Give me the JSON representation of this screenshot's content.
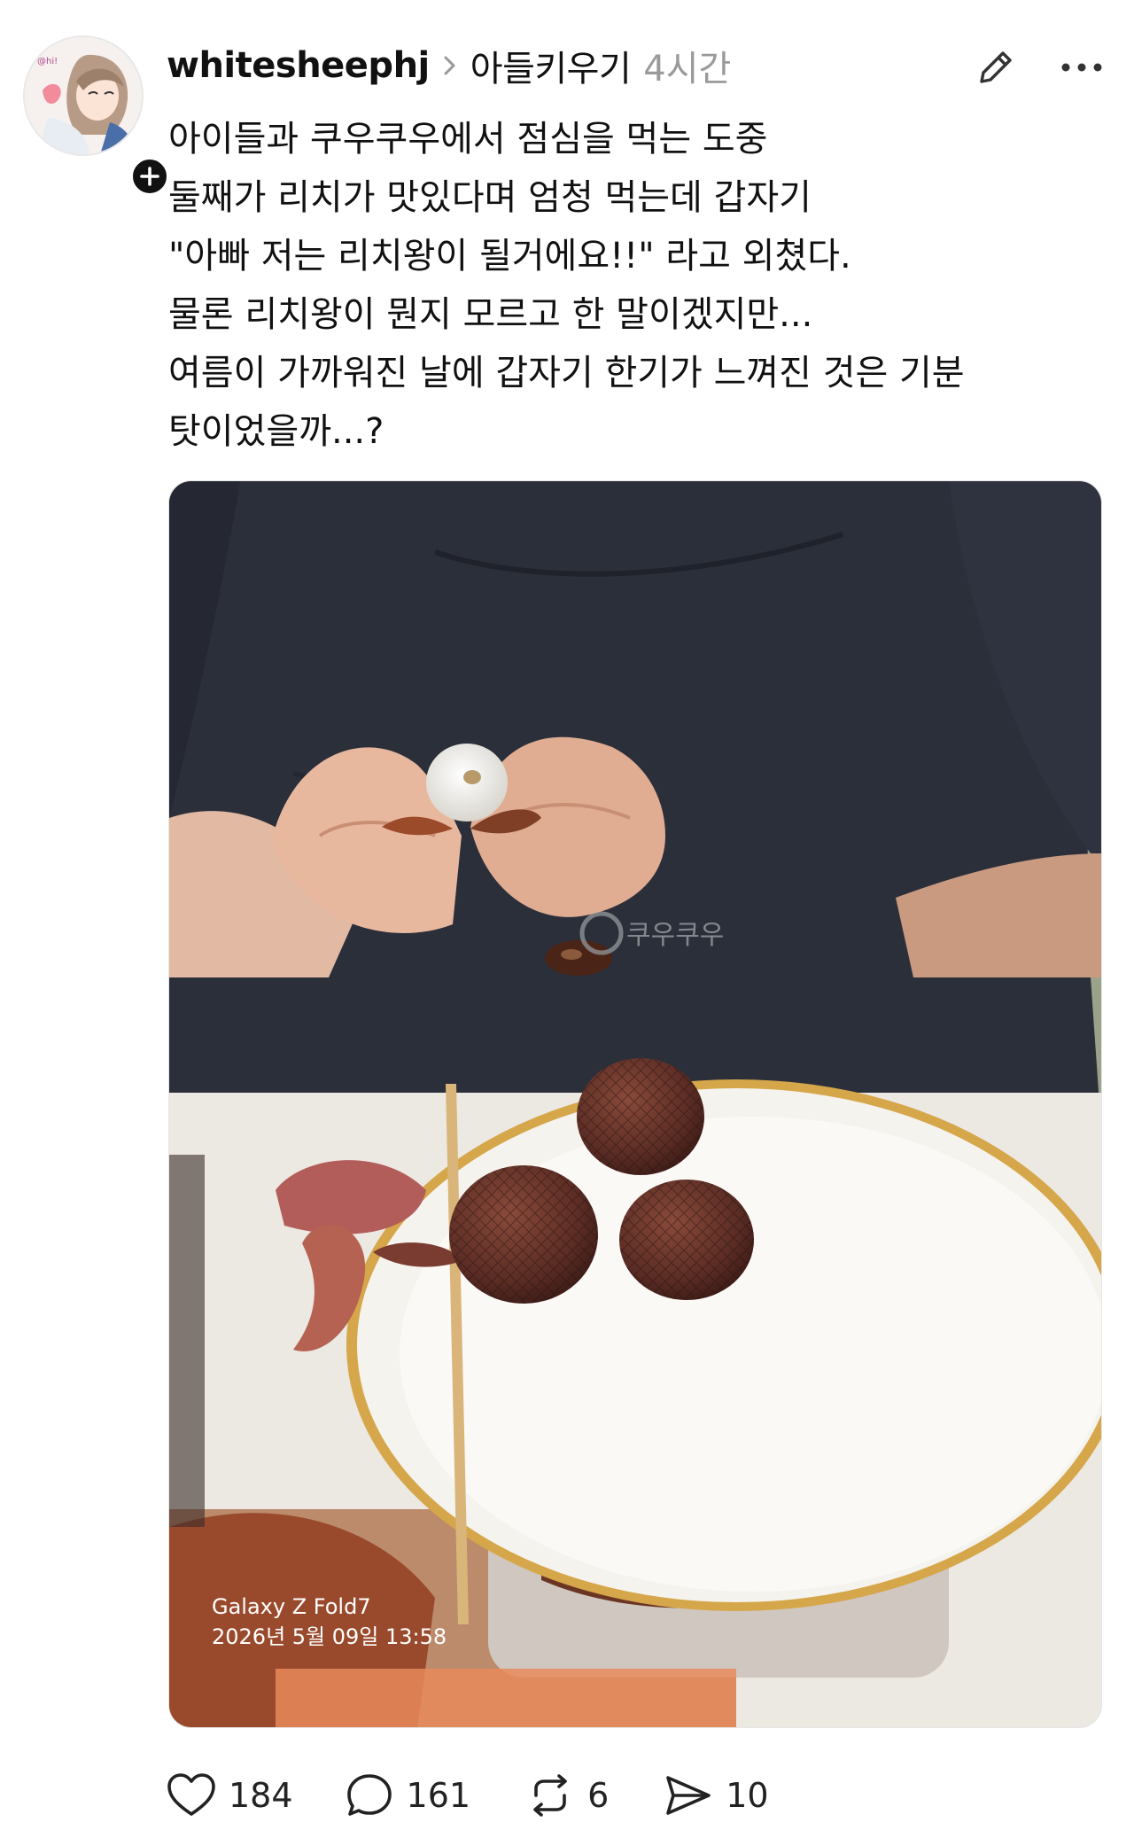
{
  "post": {
    "username": "whitesheephj",
    "community": "아들키우기",
    "time_ago": "4시간",
    "body_lines": [
      "아이들과 쿠우쿠우에서 점심을 먹는 도중",
      "둘째가 리치가 맛있다며 엄청 먹는데 갑자기",
      "\"아빠 저는 리치왕이 될거에요!!\" 라고 외쳤다.",
      "물론 리치왕이 뭔지 모르고 한 말이겠지만...",
      "여름이 가까워진 날에 갑자기 한기가 느껴진 것은 기분",
      "탓이었을까...?"
    ],
    "photo": {
      "watermark_device": "Galaxy Z Fold7",
      "watermark_datetime": "2026년 5월 09일 13:58",
      "plate_logo": "쿠우쿠우"
    }
  },
  "actions": {
    "likes": "184",
    "comments": "161",
    "reposts": "6",
    "shares": "10"
  },
  "icons": [
    "heart-icon",
    "comment-icon",
    "repost-icon",
    "share-icon",
    "edit-icon",
    "more-icon",
    "chevron-right-icon",
    "plus-icon"
  ]
}
